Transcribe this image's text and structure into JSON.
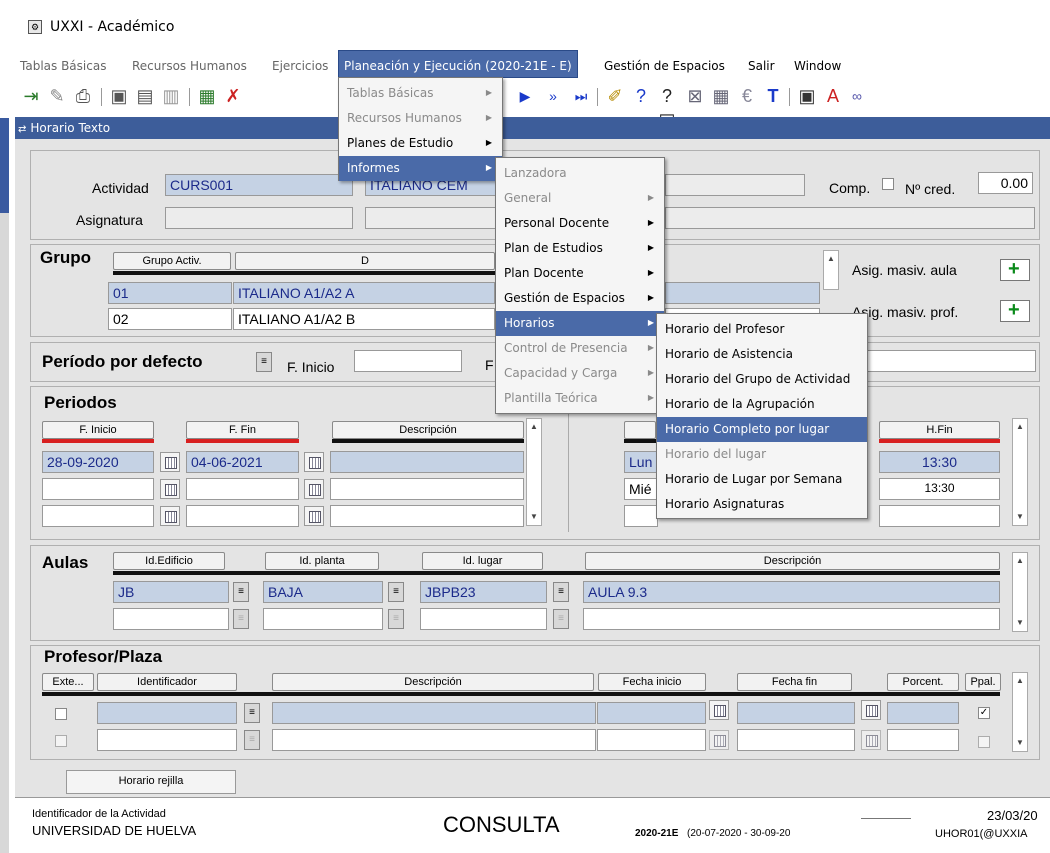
{
  "window": {
    "title": "UXXI - Académico"
  },
  "menubar": [
    "Tablas Básicas",
    "Recursos Humanos",
    "Ejercicios",
    "Planeación y Ejecución  (2020-21E - E)",
    "Gestión de Espacios",
    "Salir",
    "Window"
  ],
  "form": {
    "title": "Horario Texto"
  },
  "activity": {
    "label_actividad": "Actividad",
    "actividad_code": "CURS001",
    "actividad_desc": "ITALIANO CEM",
    "label_comp": "Comp.",
    "label_ncred": "Nº cred.",
    "ncred": "0.00",
    "label_asignatura": "Asignatura"
  },
  "grupo": {
    "title": "Grupo",
    "col_grupo": "Grupo Activ.",
    "col_desc": "D",
    "rows": [
      {
        "code": "01",
        "desc": "ITALIANO A1/A2 A"
      },
      {
        "code": "02",
        "desc": "ITALIANO A1/A2 B"
      }
    ],
    "label_asig_aula": "Asig. masiv. aula",
    "label_asig_prof": "Asig. masiv. prof."
  },
  "periodo_defecto": {
    "title": "Período por defecto",
    "label_inicio": "F. Inicio",
    "label_fin": "F"
  },
  "periodos": {
    "title": "Periodos",
    "col_inicio": "F. Inicio",
    "col_fin": "F. Fin",
    "col_desc": "Descripción",
    "col_hfin": "H.Fin",
    "rows": [
      {
        "inicio": "28-09-2020",
        "fin": "04-06-2021",
        "dia": "Lun",
        "hfin": "13:30"
      },
      {
        "inicio": "",
        "fin": "",
        "dia": "Mié",
        "hfin": "13:30"
      }
    ]
  },
  "aulas": {
    "title": "Aulas",
    "col_edificio": "Id.Edificio",
    "col_planta": "Id. planta",
    "col_lugar": "Id. lugar",
    "col_desc": "Descripción",
    "row": {
      "edificio": "JB",
      "planta": "BAJA",
      "lugar": "JBPB23",
      "desc": "AULA 9.3"
    }
  },
  "profesor": {
    "title": "Profesor/Plaza",
    "col_exte": "Exte...",
    "col_ident": "Identificador",
    "col_desc": "Descripción",
    "col_finicio": "Fecha inicio",
    "col_ffin": "Fecha fin",
    "col_porcent": "Porcent.",
    "col_ppal": "Ppal."
  },
  "buttons": {
    "horario_rejilla": "Horario rejilla"
  },
  "status": {
    "hint": "Identificador de la Actividad",
    "university": "UNIVERSIDAD DE HUELVA",
    "mode": "CONSULTA",
    "ejercicio": "2020-21E",
    "range": "(20-07-2020  -  30-09-20",
    "date": "23/03/20",
    "user": "UHOR01(@UXXIA"
  },
  "menu1": [
    {
      "label": "Tablas Básicas",
      "disabled": true
    },
    {
      "label": "Recursos Humanos",
      "disabled": true
    },
    {
      "label": "Planes de Estudio",
      "disabled": false
    },
    {
      "label": "Informes",
      "disabled": false
    }
  ],
  "menu2": [
    {
      "label": "Lanzadora",
      "disabled": true
    },
    {
      "label": "General",
      "disabled": true
    },
    {
      "label": "Personal Docente",
      "disabled": false
    },
    {
      "label": "Plan de Estudios",
      "disabled": false
    },
    {
      "label": "Plan Docente",
      "disabled": false
    },
    {
      "label": "Gestión de Espacios",
      "disabled": false
    },
    {
      "label": "Horarios",
      "disabled": false
    },
    {
      "label": "Control de Presencia",
      "disabled": true
    },
    {
      "label": "Capacidad y Carga",
      "disabled": true
    },
    {
      "label": "Plantilla Teórica",
      "disabled": true
    }
  ],
  "menu3": [
    {
      "label": "Horario del Profesor",
      "disabled": false
    },
    {
      "label": "Horario de Asistencia",
      "disabled": false
    },
    {
      "label": "Horario del Grupo de Actividad",
      "disabled": false
    },
    {
      "label": "Horario de la Agrupación",
      "disabled": false
    },
    {
      "label": "Horario Completo por lugar",
      "disabled": false
    },
    {
      "label": "Horario del lugar",
      "disabled": true
    },
    {
      "label": "Horario de Lugar por Semana",
      "disabled": false
    },
    {
      "label": "Horario Asignaturas",
      "disabled": false
    }
  ]
}
